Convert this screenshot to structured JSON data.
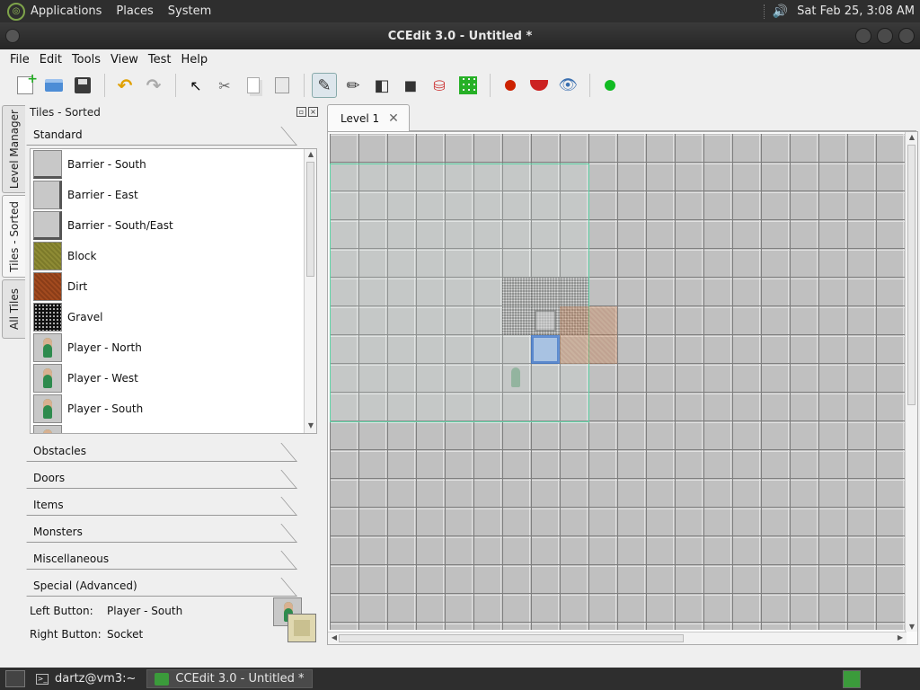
{
  "top_panel": {
    "menus": [
      "Applications",
      "Places",
      "System"
    ],
    "clock": "Sat Feb 25,  3:08 AM"
  },
  "window": {
    "title": "CCEdit 3.0 - Untitled *"
  },
  "menubar": [
    "File",
    "Edit",
    "Tools",
    "View",
    "Test",
    "Help"
  ],
  "toolbar": {
    "icons": [
      "new-file-icon",
      "open-file-icon",
      "save-icon",
      "undo-icon",
      "redo-icon",
      "select-cursor-icon",
      "cut-icon",
      "copy-icon",
      "paste-icon",
      "draw-pencil-icon",
      "line-pencil-icon",
      "rectangle-pencil-icon",
      "fill-pencil-icon",
      "flood-fill-icon",
      "path-grid-icon",
      "record-icon",
      "mouth-icon",
      "eye-icon",
      "play-icon"
    ],
    "active_tool": "draw-pencil-icon"
  },
  "vertical_tabs": [
    {
      "label": "Level Manager",
      "active": false
    },
    {
      "label": "Tiles - Sorted",
      "active": true
    },
    {
      "label": "All Tiles",
      "active": false
    }
  ],
  "dock": {
    "title": "Tiles - Sorted",
    "open_section": "Standard",
    "tiles": [
      {
        "label": "Barrier - South",
        "icon": "barrier-south-tile-icon"
      },
      {
        "label": "Barrier - East",
        "icon": "barrier-east-tile-icon"
      },
      {
        "label": "Barrier - South/East",
        "icon": "barrier-southeast-tile-icon"
      },
      {
        "label": "Block",
        "icon": "block-tile-icon"
      },
      {
        "label": "Dirt",
        "icon": "dirt-tile-icon"
      },
      {
        "label": "Gravel",
        "icon": "gravel-tile-icon"
      },
      {
        "label": "Player - North",
        "icon": "player-north-tile-icon"
      },
      {
        "label": "Player - West",
        "icon": "player-west-tile-icon"
      },
      {
        "label": "Player - South",
        "icon": "player-south-tile-icon"
      }
    ],
    "sections": [
      "Obstacles",
      "Doors",
      "Items",
      "Monsters",
      "Miscellaneous",
      "Special (Advanced)"
    ],
    "left_button_label": "Left Button:",
    "left_button_value": "Player - South",
    "right_button_label": "Right Button:",
    "right_button_value": "Socket"
  },
  "editor": {
    "tab_label": "Level 1",
    "tab_close": "✕"
  },
  "taskbar": {
    "tasks": [
      {
        "label": "dartz@vm3:~",
        "active": false
      },
      {
        "label": "CCEdit 3.0 - Untitled *",
        "active": true
      }
    ]
  }
}
